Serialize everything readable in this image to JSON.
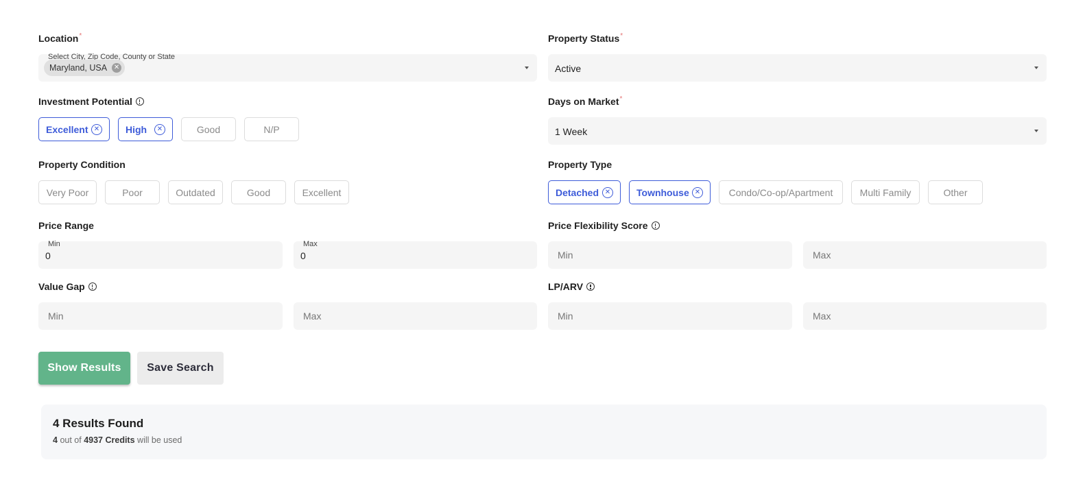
{
  "location": {
    "label": "Location",
    "required": "*",
    "small_label": "Select City, Zip Code, County or State",
    "chip": "Maryland, USA"
  },
  "property_status": {
    "label": "Property Status",
    "required": "*",
    "value": "Active"
  },
  "investment_potential": {
    "label": "Investment Potential",
    "options": [
      {
        "label": "Excellent",
        "selected": true
      },
      {
        "label": "High",
        "selected": true
      },
      {
        "label": "Good",
        "selected": false
      },
      {
        "label": "N/P",
        "selected": false
      }
    ]
  },
  "days_on_market": {
    "label": "Days on Market",
    "required": "*",
    "value": "1 Week"
  },
  "property_condition": {
    "label": "Property Condition",
    "options": [
      {
        "label": "Very Poor",
        "selected": false
      },
      {
        "label": "Poor",
        "selected": false
      },
      {
        "label": "Outdated",
        "selected": false
      },
      {
        "label": "Good",
        "selected": false
      },
      {
        "label": "Excellent",
        "selected": false
      }
    ]
  },
  "property_type": {
    "label": "Property Type",
    "options": [
      {
        "label": "Detached",
        "selected": true
      },
      {
        "label": "Townhouse",
        "selected": true
      },
      {
        "label": "Condo/Co-op/Apartment",
        "selected": false
      },
      {
        "label": "Multi Family",
        "selected": false
      },
      {
        "label": "Other",
        "selected": false
      }
    ]
  },
  "price_range": {
    "label": "Price Range",
    "min_label": "Min",
    "min_value": "0",
    "max_label": "Max",
    "max_value": "0"
  },
  "price_flexibility": {
    "label": "Price Flexibility Score",
    "min_placeholder": "Min",
    "max_placeholder": "Max"
  },
  "value_gap": {
    "label": "Value Gap",
    "min_placeholder": "Min",
    "max_placeholder": "Max"
  },
  "lp_arv": {
    "label": "LP/ARV",
    "min_placeholder": "Min",
    "max_placeholder": "Max"
  },
  "buttons": {
    "show_results": "Show Results",
    "save_search": "Save Search"
  },
  "results": {
    "title": "4 Results Found",
    "count": "4",
    "out_of": "out of",
    "credits": "4937 Credits",
    "suffix": "will be used"
  },
  "colors": {
    "accent_blue": "#3d5bd9",
    "primary_green": "#62b48a",
    "required_red": "#e57373"
  }
}
